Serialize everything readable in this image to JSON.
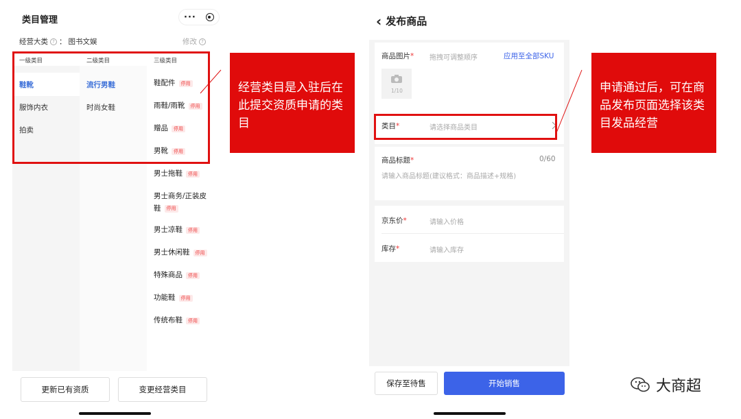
{
  "left": {
    "title": "类目管理",
    "more": "···",
    "biz_label": "经营大类",
    "biz_info": "?",
    "biz_value": "图书文娱",
    "modify": "修改",
    "col_headers": [
      "一级类目",
      "二级类目",
      "三级类目"
    ],
    "level1": [
      "鞋靴",
      "服饰内衣",
      "拍卖"
    ],
    "level2": [
      "流行男鞋",
      "时尚女鞋"
    ],
    "level3": [
      {
        "name": "鞋配件",
        "tag": "停用"
      },
      {
        "name": "雨鞋/雨靴",
        "tag": "停用"
      },
      {
        "name": "赠品",
        "tag": "停用"
      },
      {
        "name": "男靴",
        "tag": "停用"
      },
      {
        "name": "男士拖鞋",
        "tag": "停用"
      },
      {
        "name": "男士商务/正装皮",
        "name2": "鞋",
        "tag": "停用"
      },
      {
        "name": "男士凉鞋",
        "tag": "停用"
      },
      {
        "name": "男士休闲鞋",
        "tag": "停用"
      },
      {
        "name": "特殊商品",
        "tag": "停用"
      },
      {
        "name": "功能鞋",
        "tag": "停用"
      },
      {
        "name": "传统布鞋",
        "tag": "停用"
      }
    ],
    "btn_update": "更新已有资质",
    "btn_change": "变更经营类目"
  },
  "callout_left": "经营类目是入驻后在此提交资质申请的类目",
  "callout_right": "申请通过后，可在商品发布页面选择该类目发品经营",
  "right": {
    "back": "‹",
    "title": "发布商品",
    "img_label": "商品图片",
    "img_hint": "拖拽可调整顺序",
    "img_apply": "应用至全部SKU",
    "img_count": "1/10",
    "cat_label": "类目",
    "cat_placeholder": "请选择商品类目",
    "name_label": "商品标题",
    "name_count": "0/60",
    "name_placeholder": "请输入商品标题(建议格式：商品描述+规格)",
    "price_label": "京东价",
    "price_placeholder": "请输入价格",
    "stock_label": "库存",
    "stock_placeholder": "请输入库存",
    "req": "*",
    "btn_save": "保存至待售",
    "btn_start": "开始销售"
  },
  "brand": "大商超"
}
